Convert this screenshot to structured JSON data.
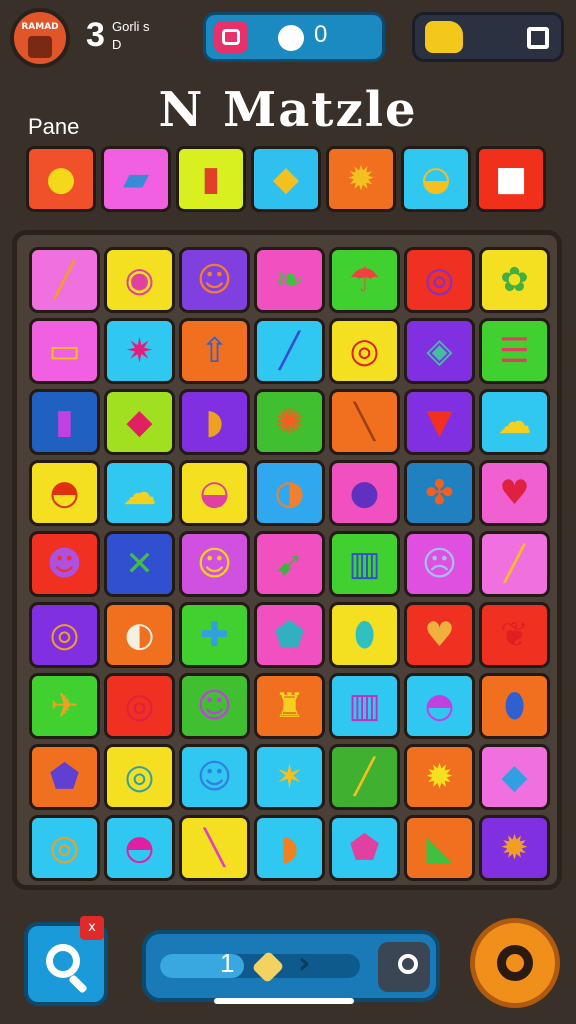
{
  "hud": {
    "avatar_text": "RAMAD",
    "level": "3",
    "level_caption_1": "Gorli s",
    "level_caption_2": "D",
    "score": "0",
    "stop_label": ""
  },
  "title": "N Matzle",
  "pane_label": "Pane",
  "preview_tiles": [
    {
      "bg": "#f0502a",
      "glyph": "●",
      "gc": "#f4d81a",
      "name": "lemon-icon"
    },
    {
      "bg": "#f060e0",
      "glyph": "▰",
      "gc": "#3a8ad8",
      "name": "eraser-icon"
    },
    {
      "bg": "#d8f020",
      "glyph": "▮",
      "gc": "#e0402a",
      "name": "book-icon"
    },
    {
      "bg": "#30c0f0",
      "glyph": "◆",
      "gc": "#f4c020",
      "name": "bow-icon"
    },
    {
      "bg": "#f07020",
      "glyph": "✹",
      "gc": "#f4c020",
      "name": "sun-icon"
    },
    {
      "bg": "#30c8f0",
      "glyph": "◒",
      "gc": "#f4c020",
      "name": "bowl-icon"
    },
    {
      "bg": "#f0301a",
      "glyph": "■",
      "gc": "#ffffff",
      "name": "box-icon"
    }
  ],
  "board_rows": [
    [
      {
        "bg": "#f070e0",
        "glyph": "╱",
        "gc": "#f0a020",
        "name": "pencil-icon"
      },
      {
        "bg": "#f4e020",
        "glyph": "◉",
        "gc": "#e040a0",
        "name": "disc-icon"
      },
      {
        "bg": "#8040e0",
        "glyph": "☺",
        "gc": "#f08030",
        "name": "face-icon"
      },
      {
        "bg": "#f050c0",
        "glyph": "❧",
        "gc": "#40c040",
        "name": "leaf-icon"
      },
      {
        "bg": "#40d030",
        "glyph": "☂",
        "gc": "#f04040",
        "name": "umbrella-icon"
      },
      {
        "bg": "#f03020",
        "glyph": "◎",
        "gc": "#8030d0",
        "name": "ring-icon"
      },
      {
        "bg": "#f4e020",
        "glyph": "✿",
        "gc": "#40b040",
        "name": "plant-icon"
      }
    ],
    [
      {
        "bg": "#f060e0",
        "glyph": "▭",
        "gc": "#f4c020",
        "name": "stick-icon"
      },
      {
        "bg": "#30c8f0",
        "glyph": "✷",
        "gc": "#e02080",
        "name": "star-box-icon"
      },
      {
        "bg": "#f07020",
        "glyph": "⇧",
        "gc": "#3060d0",
        "name": "arrow-icon"
      },
      {
        "bg": "#30c8f0",
        "glyph": "╱",
        "gc": "#3050d0",
        "name": "marker-icon"
      },
      {
        "bg": "#f4e020",
        "glyph": "◎",
        "gc": "#e02020",
        "name": "target-icon"
      },
      {
        "bg": "#8030e0",
        "glyph": "◈",
        "gc": "#40c0a0",
        "name": "candy-icon"
      },
      {
        "bg": "#40d030",
        "glyph": "☰",
        "gc": "#e04060",
        "name": "stripes-icon"
      }
    ],
    [
      {
        "bg": "#2060c0",
        "glyph": "▮",
        "gc": "#c040e0",
        "name": "battery-icon"
      },
      {
        "bg": "#a0e020",
        "glyph": "◆",
        "gc": "#e02060",
        "name": "gem-icon"
      },
      {
        "bg": "#8030e0",
        "glyph": "◗",
        "gc": "#f0a020",
        "name": "shell-icon"
      },
      {
        "bg": "#40c030",
        "glyph": "✺",
        "gc": "#f06020",
        "name": "hedgehog-icon"
      },
      {
        "bg": "#f07020",
        "glyph": "╲",
        "gc": "#a04010",
        "name": "bat-icon"
      },
      {
        "bg": "#8030e0",
        "glyph": "▼",
        "gc": "#f03020",
        "name": "kite-icon"
      },
      {
        "bg": "#30c8f0",
        "glyph": "☁",
        "gc": "#f4d020",
        "name": "cloud-icon"
      }
    ],
    [
      {
        "bg": "#f4e020",
        "glyph": "◓",
        "gc": "#e03010",
        "name": "pot-icon"
      },
      {
        "bg": "#30c8f0",
        "glyph": "☁",
        "gc": "#f4d020",
        "name": "sponge-icon"
      },
      {
        "bg": "#f4e020",
        "glyph": "◒",
        "gc": "#e040a0",
        "name": "cup-icon"
      },
      {
        "bg": "#30a8f0",
        "glyph": "◑",
        "gc": "#f08030",
        "name": "ball-icon"
      },
      {
        "bg": "#f050c0",
        "glyph": "●",
        "gc": "#6030c0",
        "name": "berry-icon"
      },
      {
        "bg": "#2080c0",
        "glyph": "✤",
        "gc": "#f06020",
        "name": "bug-icon"
      },
      {
        "bg": "#f060d0",
        "glyph": "♥",
        "gc": "#e02040",
        "name": "heart-icon"
      }
    ],
    [
      {
        "bg": "#f03020",
        "glyph": "☻",
        "gc": "#b050e0",
        "name": "monster-icon"
      },
      {
        "bg": "#3050d0",
        "glyph": "✕",
        "gc": "#40c040",
        "name": "cross-icon"
      },
      {
        "bg": "#d050e0",
        "glyph": "☺",
        "gc": "#f4d020",
        "name": "grin-icon"
      },
      {
        "bg": "#f050c0",
        "glyph": "➹",
        "gc": "#40b040",
        "name": "dart-icon"
      },
      {
        "bg": "#40d030",
        "glyph": "▥",
        "gc": "#3050d0",
        "name": "crate-icon"
      },
      {
        "bg": "#e050e0",
        "glyph": "☹",
        "gc": "#a0c0f0",
        "name": "mask-icon"
      },
      {
        "bg": "#f070e0",
        "glyph": "╱",
        "gc": "#f4c020",
        "name": "crayon-icon"
      }
    ],
    [
      {
        "bg": "#8030e0",
        "glyph": "◎",
        "gc": "#f0a020",
        "name": "spiral-icon"
      },
      {
        "bg": "#f07020",
        "glyph": "◐",
        "gc": "#f4f0e0",
        "name": "balloon-icon"
      },
      {
        "bg": "#40d030",
        "glyph": "✚",
        "gc": "#30a0e0",
        "name": "puzzle-icon"
      },
      {
        "bg": "#f050c0",
        "glyph": "⬟",
        "gc": "#30b0c0",
        "name": "shield-icon"
      },
      {
        "bg": "#f4e020",
        "glyph": "⬮",
        "gc": "#30c0c0",
        "name": "vase-icon"
      },
      {
        "bg": "#f03020",
        "glyph": "♥",
        "gc": "#f0b040",
        "name": "cookie-icon"
      },
      {
        "bg": "#f03020",
        "glyph": "❦",
        "gc": "#e02020",
        "name": "pepper-icon"
      }
    ],
    [
      {
        "bg": "#40d030",
        "glyph": "✈",
        "gc": "#f0a020",
        "name": "plane-icon"
      },
      {
        "bg": "#f03020",
        "glyph": "◎",
        "gc": "#e02040",
        "name": "swirl-icon"
      },
      {
        "bg": "#40c030",
        "glyph": "☺",
        "gc": "#c040e0",
        "name": "cat-icon"
      },
      {
        "bg": "#f07020",
        "glyph": "♜",
        "gc": "#f4d020",
        "name": "bell-icon"
      },
      {
        "bg": "#30c8f0",
        "glyph": "▥",
        "gc": "#c030c0",
        "name": "cabinet-icon"
      },
      {
        "bg": "#30c8f0",
        "glyph": "◓",
        "gc": "#c040e0",
        "name": "cupcake-icon"
      },
      {
        "bg": "#f07020",
        "glyph": "⬮",
        "gc": "#3060d0",
        "name": "hot-air-balloon-icon"
      }
    ],
    [
      {
        "bg": "#f07020",
        "glyph": "⬟",
        "gc": "#6040d0",
        "name": "badge-icon"
      },
      {
        "bg": "#f4e020",
        "glyph": "◎",
        "gc": "#30a0a0",
        "name": "loop-icon"
      },
      {
        "bg": "#30c8f0",
        "glyph": "☺",
        "gc": "#3080e0",
        "name": "smiley-icon"
      },
      {
        "bg": "#30c8f0",
        "glyph": "✶",
        "gc": "#f4c020",
        "name": "star-icon"
      },
      {
        "bg": "#40b030",
        "glyph": "╱",
        "gc": "#f4c020",
        "name": "corn-icon"
      },
      {
        "bg": "#f07020",
        "glyph": "✹",
        "gc": "#f4e020",
        "name": "flower-icon"
      },
      {
        "bg": "#f070e0",
        "glyph": "◆",
        "gc": "#30a0e0",
        "name": "diamond-icon"
      }
    ],
    [
      {
        "bg": "#30c8f0",
        "glyph": "◎",
        "gc": "#f0a020",
        "name": "rainbow-ring-icon"
      },
      {
        "bg": "#30c8f0",
        "glyph": "◓",
        "gc": "#e020a0",
        "name": "jelly-icon"
      },
      {
        "bg": "#f4e020",
        "glyph": "╲",
        "gc": "#e040c0",
        "name": "slipper-icon"
      },
      {
        "bg": "#30c8f0",
        "glyph": "◗",
        "gc": "#f08020",
        "name": "banana-icon"
      },
      {
        "bg": "#30c8f0",
        "glyph": "⬟",
        "gc": "#e040a0",
        "name": "star-shield-icon"
      },
      {
        "bg": "#f07020",
        "glyph": "◣",
        "gc": "#40c040",
        "name": "carrot-icon"
      },
      {
        "bg": "#8030e0",
        "glyph": "✹",
        "gc": "#f0a020",
        "name": "sunface-icon"
      }
    ]
  ],
  "bottom": {
    "notification_count": "x",
    "progress_value": "1",
    "progress_fraction": 0.42
  },
  "colors": {
    "background": "#3a302a",
    "score_pill": "#1a8ac0",
    "gear": "#f0901a"
  }
}
